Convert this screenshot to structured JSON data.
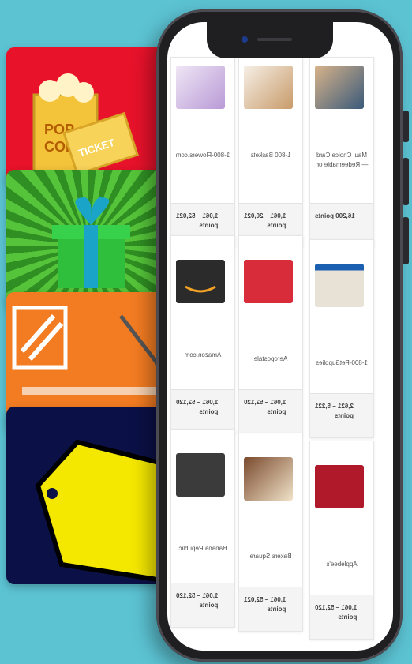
{
  "cards": [
    {
      "name": "popcorn-ticket-card",
      "words": [
        "POP",
        "CORN",
        "TICKET"
      ]
    },
    {
      "name": "gift-box-card"
    },
    {
      "name": "home-depot-card"
    },
    {
      "name": "price-tag-card"
    }
  ],
  "tiles": [
    {
      "name": "1-800-Flowers.com",
      "points": "1,061 – 52,021\npoints"
    },
    {
      "name": "1-800 Baskets",
      "points": "1,061 – 20,021\npoints"
    },
    {
      "name": "Maui Choice Card — Redeemable on",
      "points": "16,200 points"
    },
    {
      "name": "Amazon.com",
      "points": "1,061 – 52,120\npoints"
    },
    {
      "name": "Aeropostale",
      "points": "1,061 – 52,120\npoints"
    },
    {
      "name": "1-800-PetSupplies",
      "points": "2,621 – 5,221\npoints"
    },
    {
      "name": "Banana Republic",
      "points": "1,061 – 52,120\npoints"
    },
    {
      "name": "Bakers Square",
      "points": "1,061 – 52,021\npoints"
    },
    {
      "name": "Applebee's",
      "points": "1,061 – 52,120\npoints"
    }
  ],
  "colors": {
    "background": "#5cc3d3",
    "phone": "#1f1f22",
    "screen": "#ffffff"
  }
}
